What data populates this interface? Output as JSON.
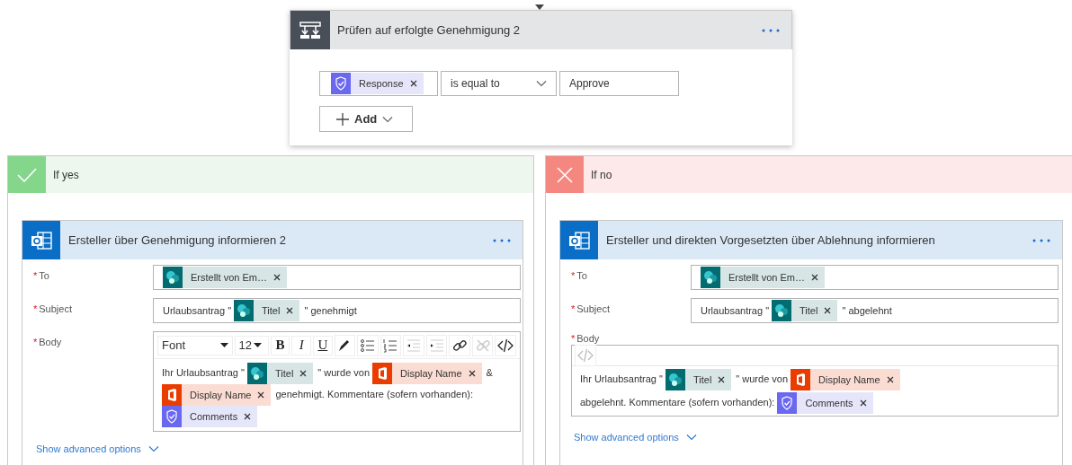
{
  "condition": {
    "title": "Prüfen auf erfolgte Genehmigung 2",
    "operand": {
      "kind": "approvals_token",
      "label": "Response"
    },
    "operator": "is equal to",
    "value": "Approve",
    "add_button": "Add"
  },
  "branches": [
    {
      "kind": "yes",
      "label": "If yes",
      "action": {
        "title": "Ersteller über Genehmigung informieren 2",
        "fields": [
          {
            "label": "To",
            "required_mark": "*",
            "label_above": false,
            "content": [
              {
                "kind": "sharepoint_token",
                "label": "Erstellt von Em…"
              }
            ]
          },
          {
            "label": "Subject",
            "required_mark": "*",
            "label_above": false,
            "content": [
              {
                "kind": "text",
                "text": "Urlaubsantrag \""
              },
              {
                "kind": "sharepoint_token",
                "label": "Titel"
              },
              {
                "kind": "text",
                "text": "\" genehmigt"
              }
            ]
          },
          {
            "label": "Body",
            "required_mark": "*",
            "label_above": false,
            "editor": {
              "kind": "rich",
              "font": "Font",
              "size": "12",
              "buttons": [
                {
                  "kind": "bold",
                  "label": "B",
                  "disabled": false
                },
                {
                  "kind": "italic",
                  "label": "I",
                  "disabled": false
                },
                {
                  "kind": "underline",
                  "label": "U",
                  "disabled": false
                },
                {
                  "kind": "pen",
                  "disabled": false
                },
                {
                  "kind": "bullets",
                  "disabled": false
                },
                {
                  "kind": "numbers",
                  "disabled": false
                },
                {
                  "kind": "outdent",
                  "disabled": true
                },
                {
                  "kind": "indent",
                  "disabled": true
                },
                {
                  "kind": "link",
                  "disabled": false
                },
                {
                  "kind": "unlink",
                  "disabled": true
                },
                {
                  "kind": "code",
                  "disabled": false
                }
              ]
            },
            "content": [
              {
                "kind": "text",
                "text": "Ihr Urlaubsantrag \""
              },
              {
                "kind": "sharepoint_token",
                "label": "Titel"
              },
              {
                "kind": "text",
                "text": "\" wurde von"
              },
              {
                "kind": "office_token",
                "label": "Display Name"
              },
              {
                "kind": "text",
                "text": "&"
              },
              {
                "kind": "office_token",
                "label": "Display Name"
              },
              {
                "kind": "text",
                "text": "genehmigt. Kommentare (sofern vorhanden):"
              },
              {
                "kind": "approvals_token",
                "label": "Comments"
              }
            ]
          }
        ],
        "advanced": "Show advanced options"
      }
    },
    {
      "kind": "no",
      "label": "If no",
      "action": {
        "title": "Ersteller und direkten Vorgesetzten über Ablehnung informieren",
        "fields": [
          {
            "label": "To",
            "required_mark": "*",
            "label_above": false,
            "content": [
              {
                "kind": "sharepoint_token",
                "label": "Erstellt von Em…"
              }
            ]
          },
          {
            "label": "Subject",
            "required_mark": "*",
            "label_above": false,
            "content": [
              {
                "kind": "text",
                "text": "Urlaubsantrag \""
              },
              {
                "kind": "sharepoint_token",
                "label": "Titel"
              },
              {
                "kind": "text",
                "text": "\" abgelehnt"
              }
            ]
          },
          {
            "label": "Body",
            "required_mark": "*",
            "label_above": true,
            "editor": {
              "kind": "code",
              "buttons": [
                {
                  "kind": "code",
                  "disabled": true
                }
              ]
            },
            "content": [
              {
                "kind": "text",
                "text": "Ihr Urlaubsantrag \""
              },
              {
                "kind": "sharepoint_token",
                "label": "Titel"
              },
              {
                "kind": "text",
                "text": "\" wurde von"
              },
              {
                "kind": "office_token",
                "label": "Display Name"
              },
              {
                "kind": "text",
                "text": "abgelehnt. Kommentare"
              },
              {
                "kind": "text",
                "text": "(sofern vorhanden):"
              },
              {
                "kind": "approvals_token",
                "label": "Comments"
              }
            ]
          }
        ],
        "advanced": "Show advanced options"
      }
    }
  ]
}
